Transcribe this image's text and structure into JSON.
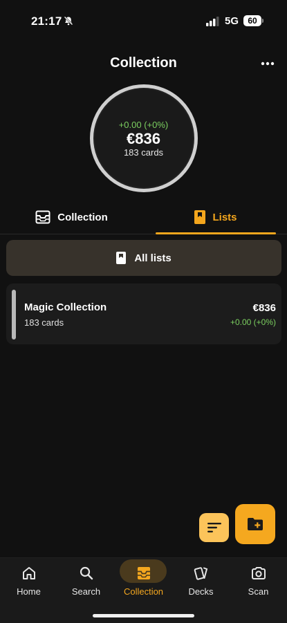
{
  "status": {
    "time": "21:17",
    "network": "5G",
    "battery": "60"
  },
  "header": {
    "title": "Collection"
  },
  "summary": {
    "change": "+0.00 (+0%)",
    "value": "€836",
    "count": "183 cards"
  },
  "tabs": [
    {
      "label": "Collection",
      "active": false
    },
    {
      "label": "Lists",
      "active": true
    }
  ],
  "all_lists": {
    "label": "All lists"
  },
  "lists": [
    {
      "name": "Magic Collection",
      "count": "183 cards",
      "value": "€836",
      "change": "+0.00 (+0%)"
    }
  ],
  "nav": [
    {
      "label": "Home",
      "icon": "home-icon"
    },
    {
      "label": "Search",
      "icon": "search-icon"
    },
    {
      "label": "Collection",
      "icon": "collection-icon",
      "active": true
    },
    {
      "label": "Decks",
      "icon": "decks-icon"
    },
    {
      "label": "Scan",
      "icon": "camera-icon"
    }
  ],
  "colors": {
    "accent": "#f5a81f",
    "positive": "#7cd060",
    "background": "#111111"
  }
}
